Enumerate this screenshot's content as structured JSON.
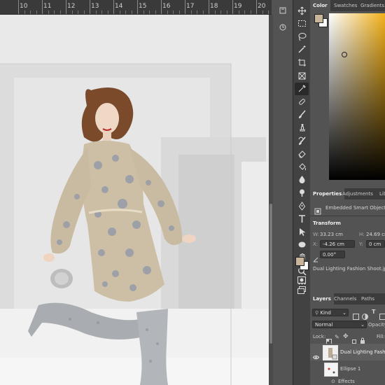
{
  "ruler": {
    "labels": [
      "10",
      "11",
      "12",
      "13",
      "14",
      "15",
      "16",
      "17",
      "18",
      "19",
      "20"
    ]
  },
  "toolbar_icons": [
    "move-icon",
    "marquee-icon",
    "lasso-icon",
    "magic-wand-icon",
    "crop-icon",
    "frame-icon",
    "eyedropper-icon",
    "healing-brush-icon",
    "brush-icon",
    "clone-stamp-icon",
    "history-brush-icon",
    "eraser-icon",
    "paint-bucket-icon",
    "blur-icon",
    "dodge-icon",
    "pen-icon",
    "type-icon",
    "path-selection-icon",
    "shape-icon",
    "hand-icon",
    "zoom-icon",
    "more-tools-icon"
  ],
  "color_panel": {
    "tabs": [
      "Color",
      "Swatches",
      "Gradients"
    ],
    "foreground": "#c9b69a",
    "background": "#ffffff",
    "hue": "#f2b11a"
  },
  "properties_panel": {
    "tabs": [
      "Properties",
      "Adjustments",
      "Libr"
    ],
    "object_type": "Embedded Smart Object",
    "section_transform": "Transform",
    "w_label": "W:",
    "w_value": "33.23 cm",
    "h_label": "H:",
    "h_value": "24.69 cm",
    "x_label": "X:",
    "x_value": "-4.26 cm",
    "y_label": "Y:",
    "y_value": "0 cm",
    "angle_value": "0.00°",
    "filename": "Dual Lighting Fashion Shoot.jpg"
  },
  "layers_panel": {
    "tabs": [
      "Layers",
      "Channels",
      "Paths"
    ],
    "filter_kind": "Kind",
    "blend_mode": "Normal",
    "opacity_label": "Opacity:",
    "lock_label": "Lock:",
    "fill_label": "Fill:",
    "layers": [
      {
        "name": "Dual Lighting Fashion"
      },
      {
        "name": "Ellipse 1"
      }
    ],
    "effects_label": "Effects"
  },
  "colors": {
    "panel_bg": "#535353",
    "toolbox_bg": "#424242",
    "tab_bg": "#3c3c3c",
    "field_bg": "#3a3a3a"
  }
}
